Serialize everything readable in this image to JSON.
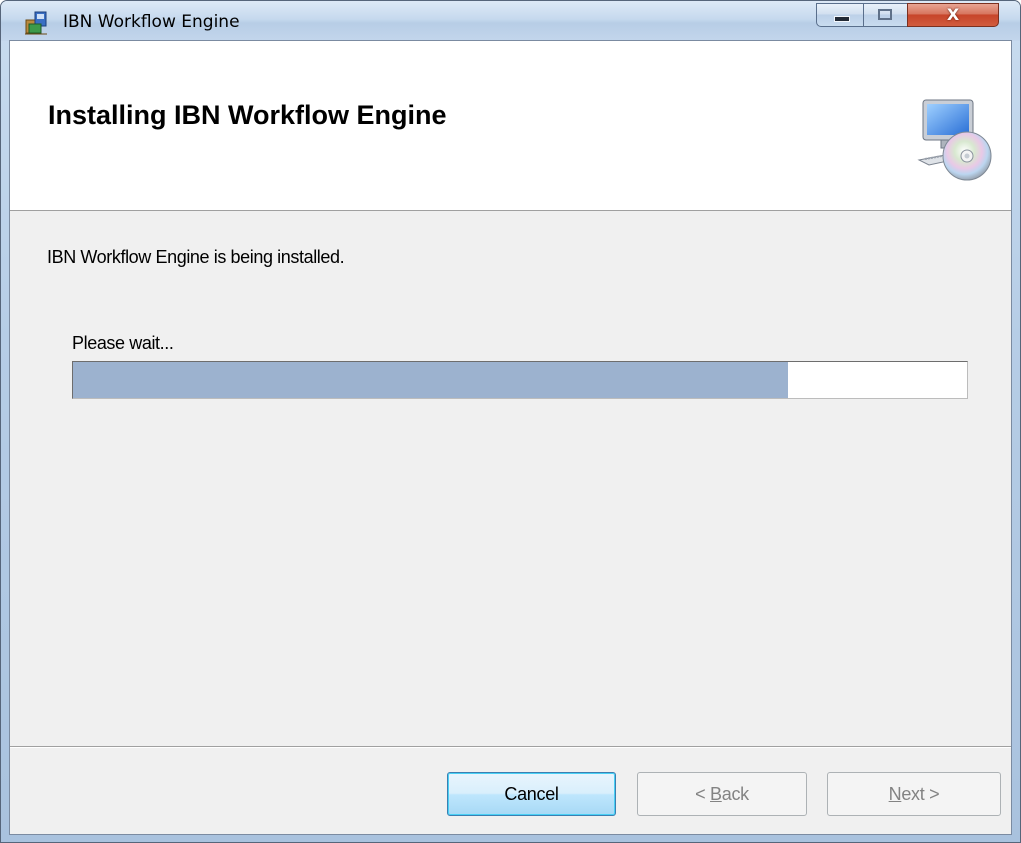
{
  "window": {
    "title": "IBN Workflow Engine",
    "close_glyph": "X"
  },
  "banner": {
    "title": "Installing IBN Workflow Engine",
    "icon": "setup-computer-disc-icon"
  },
  "body": {
    "status": "IBN Workflow Engine is being installed.",
    "wait_label": "Please wait...",
    "progress_fraction": 0.8
  },
  "buttons": {
    "cancel": "Cancel",
    "back_prefix": "< ",
    "back_hotkey": "B",
    "back_rest": "ack",
    "next_hotkey": "N",
    "next_rest": "ext >"
  },
  "colors": {
    "progress_fill": "#9cb2cf",
    "client_bg": "#f0f0f0",
    "close_button": "#c7452a"
  }
}
